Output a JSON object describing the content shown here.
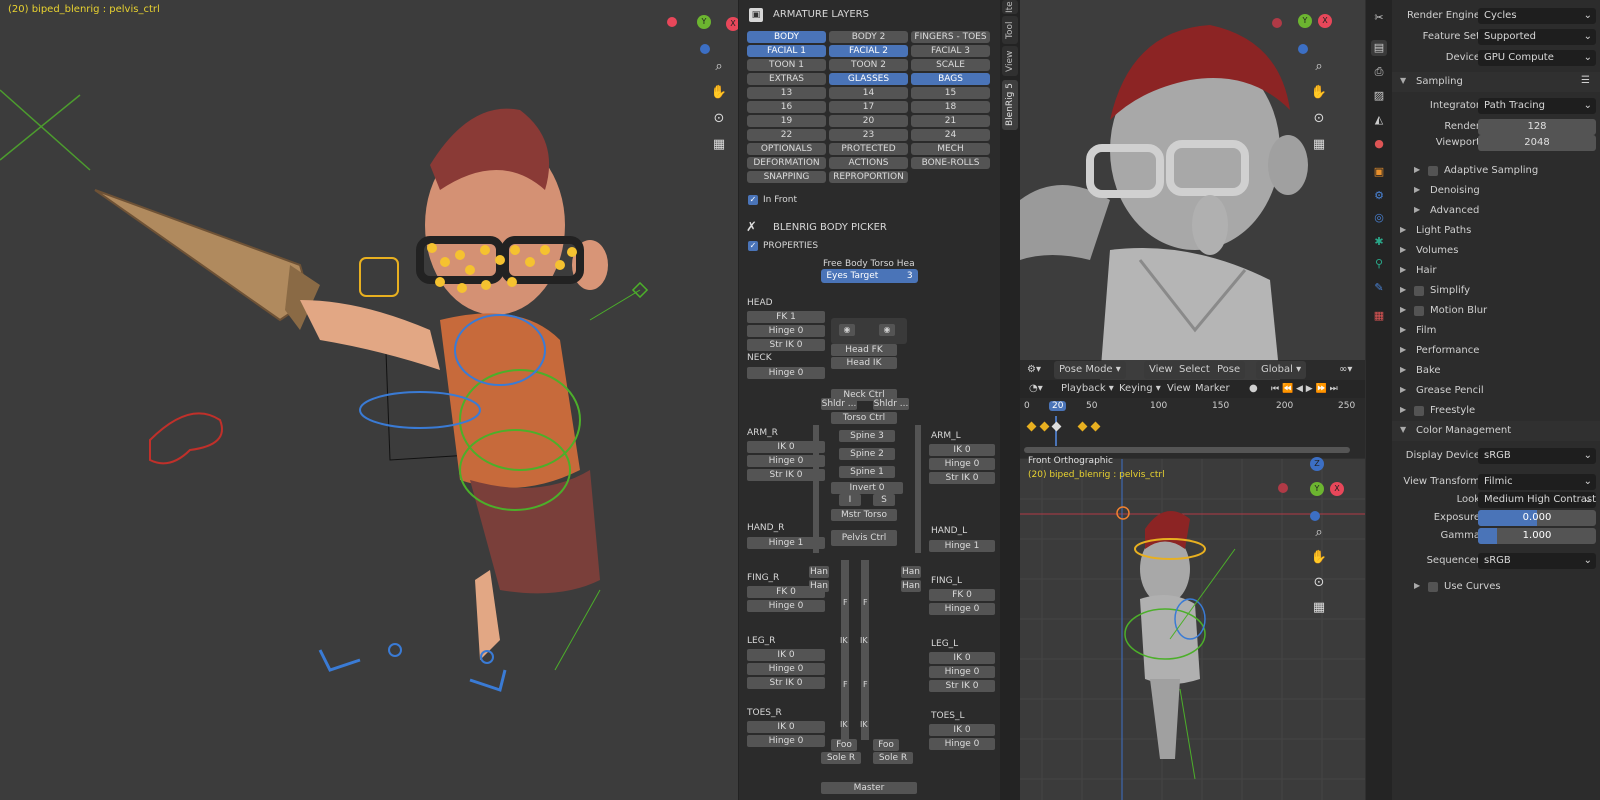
{
  "viewport_left": {
    "info": "(20) biped_blenrig : pelvis_ctrl"
  },
  "npanel": {
    "armature_title": "ARMATURE LAYERS",
    "layers": [
      {
        "label": "BODY",
        "sel": true
      },
      {
        "label": "BODY 2",
        "sel": false
      },
      {
        "label": "FINGERS - TOES",
        "sel": false
      },
      {
        "label": "FACIAL 1",
        "sel": true
      },
      {
        "label": "FACIAL 2",
        "sel": true
      },
      {
        "label": "FACIAL 3",
        "sel": false
      },
      {
        "label": "TOON 1",
        "sel": false
      },
      {
        "label": "TOON 2",
        "sel": false
      },
      {
        "label": "SCALE",
        "sel": false
      },
      {
        "label": "EXTRAS",
        "sel": false
      },
      {
        "label": "GLASSES",
        "sel": true
      },
      {
        "label": "BAGS",
        "sel": true
      },
      {
        "label": "13",
        "sel": false
      },
      {
        "label": "14",
        "sel": false
      },
      {
        "label": "15",
        "sel": false
      },
      {
        "label": "16",
        "sel": false
      },
      {
        "label": "17",
        "sel": false
      },
      {
        "label": "18",
        "sel": false
      },
      {
        "label": "19",
        "sel": false
      },
      {
        "label": "20",
        "sel": false
      },
      {
        "label": "21",
        "sel": false
      },
      {
        "label": "22",
        "sel": false
      },
      {
        "label": "23",
        "sel": false
      },
      {
        "label": "24",
        "sel": false
      },
      {
        "label": "OPTIONALS",
        "sel": false
      },
      {
        "label": "PROTECTED",
        "sel": false
      },
      {
        "label": "MECH",
        "sel": false
      },
      {
        "label": "DEFORMATION",
        "sel": false
      },
      {
        "label": "ACTIONS",
        "sel": false
      },
      {
        "label": "BONE-ROLLS",
        "sel": false
      },
      {
        "label": "SNAPPING",
        "sel": false
      },
      {
        "label": "REPROPORTION",
        "sel": false
      }
    ],
    "in_front": "In Front",
    "picker_title": "BLENRIG BODY PICKER",
    "properties": "PROPERTIES",
    "tabs_row": "Free  Body  Torso Hea",
    "eyes_target": "Eyes Target",
    "eyes_target_val": "3",
    "head": "HEAD",
    "fk1": "FK 1",
    "hinge0": "Hinge 0",
    "strik0": "Str IK 0",
    "neck": "NECK",
    "head_fk": "Head FK",
    "head_ik": "Head IK",
    "neck_ctrl": "Neck Ctrl",
    "shldr": "Shldr ...",
    "torso_ctrl": "Torso Ctrl",
    "spine3": "Spine 3",
    "spine2": "Spine 2",
    "spine1": "Spine 1",
    "invert": "Invert 0",
    "i": "I",
    "s": "S",
    "mstr_torso": "Mstr Torso",
    "pelvis_ctrl": "Pelvis Ctrl",
    "arm_r": "ARM_R",
    "arm_l": "ARM_L",
    "ik0": "IK 0",
    "fk0": "FK 0",
    "hinge1": "Hinge 1",
    "hand_r": "HAND_R",
    "hand_l": "HAND_L",
    "fing_r": "FING_R",
    "fing_l": "FING_L",
    "leg_r": "LEG_R",
    "leg_l": "LEG_L",
    "toes_r": "TOES_R",
    "toes_l": "TOES_L",
    "han": "Han",
    "f": "F",
    "ik": "IK",
    "foot": "Foo",
    "sole_r": "Sole R",
    "master": "Master"
  },
  "side_tabs": [
    "Ite",
    "Tool",
    "View",
    "BlenRig 5"
  ],
  "viewport_tr": {
    "header": {
      "mode": "Pose Mode",
      "view": "View",
      "select": "Select",
      "pose": "Pose",
      "orientation": "Global"
    }
  },
  "timeline": {
    "playback": "Playback",
    "keying": "Keying",
    "view": "View",
    "marker": "Marker",
    "ticks": [
      "0",
      "20",
      "50",
      "100",
      "150",
      "200",
      "250"
    ],
    "current_frame": "20"
  },
  "viewport_br": {
    "title": "Front Orthographic",
    "info": "(20) biped_blenrig : pelvis_ctrl"
  },
  "properties": {
    "render_engine_label": "Render Engine",
    "render_engine": "Cycles",
    "feature_set_label": "Feature Set",
    "feature_set": "Supported",
    "device_label": "Device",
    "device": "GPU Compute",
    "sampling": "Sampling",
    "integrator_label": "Integrator",
    "integrator": "Path Tracing",
    "render_label": "Render",
    "render": "128",
    "viewport_label": "Viewport",
    "viewport": "2048",
    "adaptive": "Adaptive Sampling",
    "denoising": "Denoising",
    "advanced": "Advanced",
    "sections": [
      "Light Paths",
      "Volumes",
      "Hair",
      "Simplify",
      "Motion Blur",
      "Film",
      "Performance",
      "Bake",
      "Grease Pencil",
      "Freestyle"
    ],
    "color_mgmt": "Color Management",
    "display_device_label": "Display Device",
    "display_device": "sRGB",
    "view_transform_label": "View Transform",
    "view_transform": "Filmic",
    "look_label": "Look",
    "look": "Medium High Contrast",
    "exposure_label": "Exposure",
    "exposure": "0.000",
    "gamma_label": "Gamma",
    "gamma": "1.000",
    "sequencer_label": "Sequencer",
    "sequencer": "sRGB",
    "use_curves": "Use Curves"
  }
}
